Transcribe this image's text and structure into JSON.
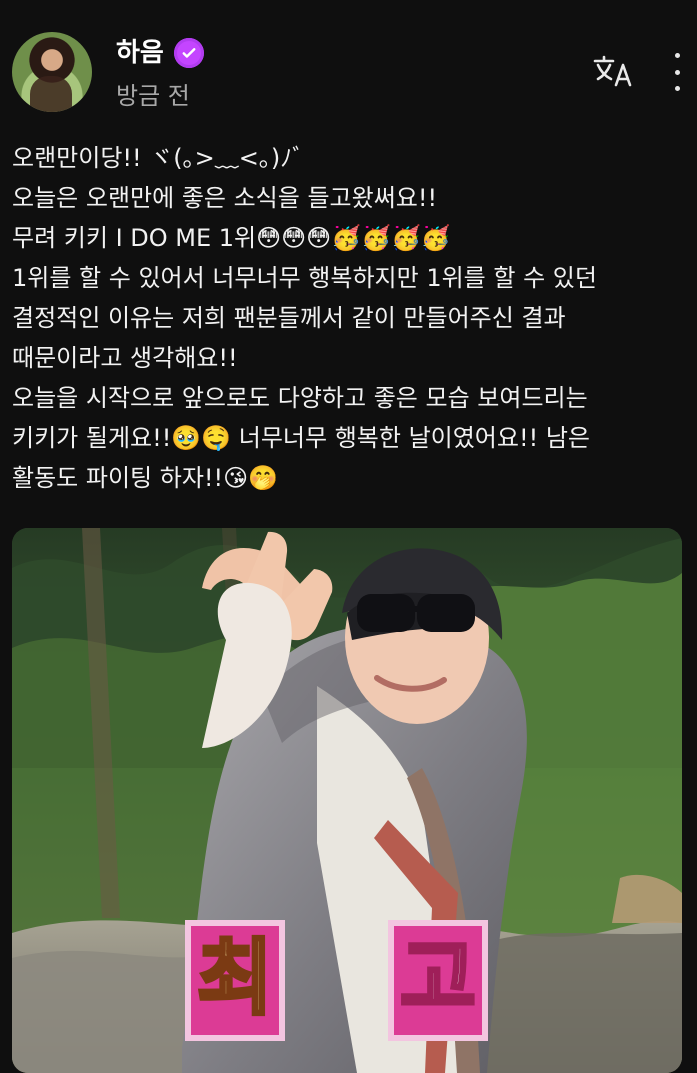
{
  "header": {
    "username": "하음",
    "time": "방금 전"
  },
  "post": {
    "lines": [
      "오랜만이당!! ヾ(｡>﹏<｡)ﾉﾞ",
      "오늘은 오랜만에 좋은 소식을 들고왔써요!!",
      "무려 키키 I DO ME 1위😳😳😳🥳🥳🥳🥳",
      "1위를 할 수 있어서 너무너무 행복하지만 1위를 할 수 있던",
      "결정적인 이유는 저희 팬분들께서 같이 만들어주신 결과",
      "때문이라고 생각해요!!",
      "오늘을 시작으로 앞으로도 다양하고 좋은 모습 보여드리는",
      "키키가 될게요!!🥹🤤 너무너무 행복한 날이였어요!! 남은",
      "활동도 파이팅 하자!!😘🤭"
    ]
  },
  "media": {
    "caption_left": "최",
    "caption_right": "고"
  },
  "colors": {
    "background": "#0f0f0f",
    "verified": "#c445ff",
    "caption_bg": "#e03a94"
  },
  "icons": [
    "verified-badge-icon",
    "translate-icon",
    "more-options-icon"
  ]
}
